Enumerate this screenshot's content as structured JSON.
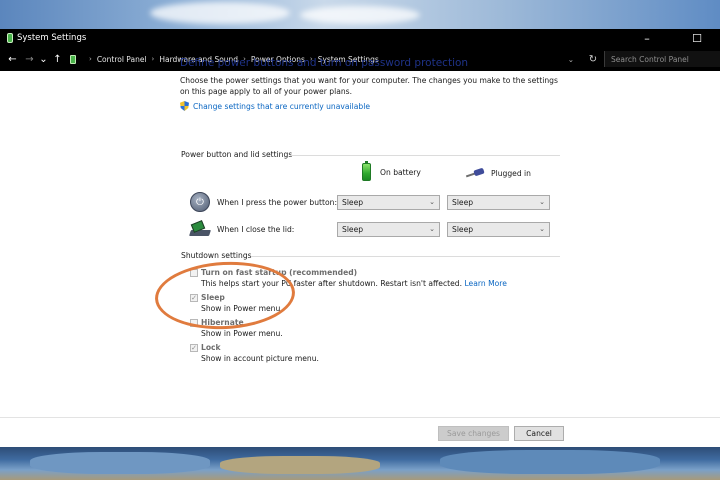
{
  "window": {
    "title": "System Settings",
    "controls": {
      "minimize": "–",
      "maximize": "☐"
    }
  },
  "address": {
    "back": "←",
    "forward": "→",
    "recent": "⌄",
    "up": "↑",
    "breadcrumbs": [
      "Control Panel",
      "Hardware and Sound",
      "Power Options",
      "System Settings"
    ],
    "separator": "›",
    "dropdown": "⌄",
    "refresh": "↻",
    "search_placeholder": "Search Control Panel"
  },
  "page": {
    "heading": "Define power buttons and turn on password protection",
    "intro": "Choose the power settings that you want for your computer. The changes you make to the settings on this page apply to all of your power plans.",
    "change_link": "Change settings that are currently unavailable"
  },
  "power_section": {
    "label": "Power button and lid settings",
    "columns": {
      "battery": "On battery",
      "plugged": "Plugged in"
    },
    "rows": [
      {
        "label": "When I press the power button:",
        "battery": "Sleep",
        "plugged": "Sleep",
        "icon": "power-icon"
      },
      {
        "label": "When I close the lid:",
        "battery": "Sleep",
        "plugged": "Sleep",
        "icon": "laptop-lid-icon"
      }
    ],
    "caret": "⌄"
  },
  "shutdown_section": {
    "label": "Shutdown settings",
    "items": [
      {
        "title": "Turn on fast startup (recommended)",
        "desc": "This helps start your PC faster after shutdown. Restart isn't affected.",
        "link": "Learn More",
        "checked": false,
        "mark": ""
      },
      {
        "title": "Sleep",
        "desc": "Show in Power menu.",
        "checked": true,
        "mark": "✓"
      },
      {
        "title": "Hibernate",
        "desc": "Show in Power menu.",
        "checked": false,
        "mark": ""
      },
      {
        "title": "Lock",
        "desc": "Show in account picture menu.",
        "checked": true,
        "mark": "✓"
      }
    ]
  },
  "footer": {
    "save": "Save changes",
    "cancel": "Cancel"
  },
  "colors": {
    "heading": "#1e3287",
    "link": "#0a66c2",
    "annotation": "#e07b3e",
    "titlebar": "#000000"
  }
}
